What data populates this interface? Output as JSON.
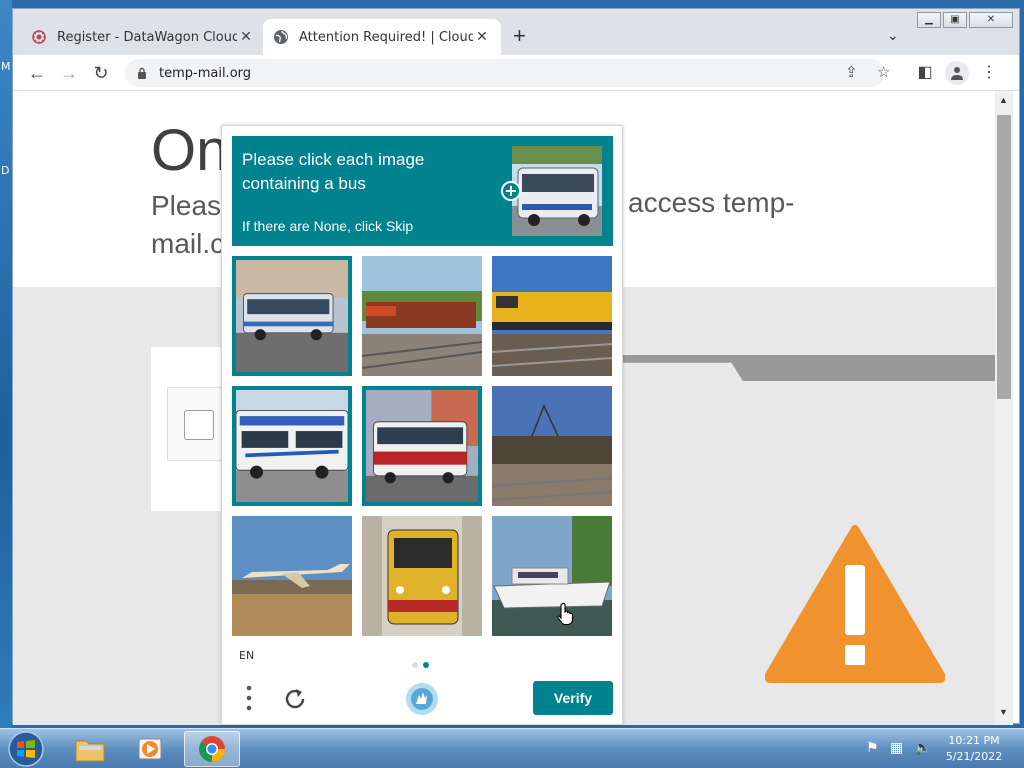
{
  "desktop": {
    "edge_letters": [
      "M",
      "D"
    ]
  },
  "tabs": [
    {
      "title": "Register - DataWagon Cloud",
      "active": false
    },
    {
      "title": "Attention Required! | Cloudflare",
      "active": true
    }
  ],
  "address_bar": {
    "url": "temp-mail.org"
  },
  "page": {
    "heading": "On",
    "subtitle_line1": "Please",
    "subtitle_line2": "mail.c",
    "subtitle_right": "access temp-"
  },
  "captcha": {
    "prompt": "Please click each image containing a bus",
    "hint": "If there are None, click Skip",
    "language": "EN",
    "verify_label": "Verify",
    "accent_color": "#00838f",
    "tiles": [
      {
        "subject": "city bus",
        "selected": true
      },
      {
        "subject": "red train",
        "selected": false
      },
      {
        "subject": "yellow locomotive",
        "selected": false
      },
      {
        "subject": "articulated bus",
        "selected": true
      },
      {
        "subject": "double-decker bus",
        "selected": true
      },
      {
        "subject": "freight train",
        "selected": false
      },
      {
        "subject": "airplane",
        "selected": false
      },
      {
        "subject": "train front",
        "selected": false
      },
      {
        "subject": "boat",
        "selected": false
      }
    ],
    "pages": 2,
    "current_page": 2
  },
  "taskbar": {
    "apps": [
      "explorer",
      "media-player",
      "chrome"
    ],
    "time": "10:21 PM",
    "date": "5/21/2022"
  }
}
